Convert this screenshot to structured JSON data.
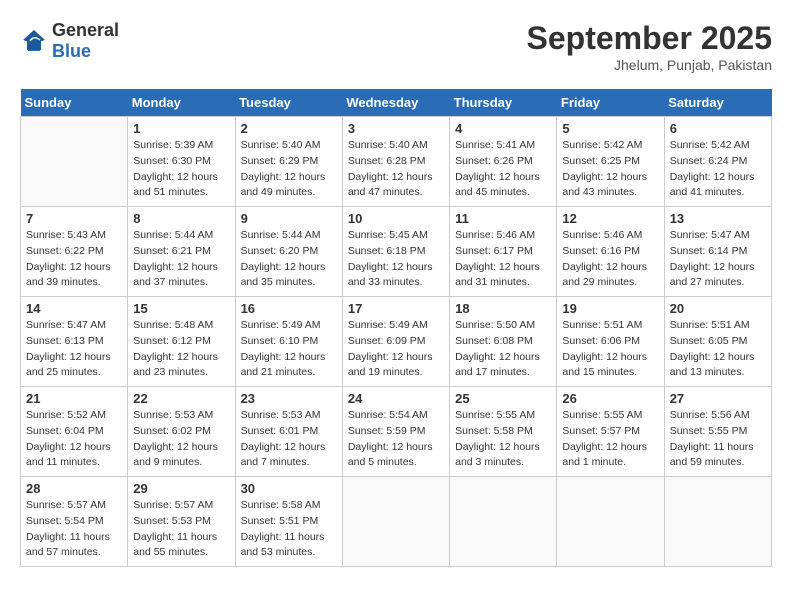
{
  "header": {
    "logo_general": "General",
    "logo_blue": "Blue",
    "title": "September 2025",
    "location": "Jhelum, Punjab, Pakistan"
  },
  "columns": [
    "Sunday",
    "Monday",
    "Tuesday",
    "Wednesday",
    "Thursday",
    "Friday",
    "Saturday"
  ],
  "weeks": [
    [
      {
        "day": "",
        "info": ""
      },
      {
        "day": "1",
        "sunrise": "5:39 AM",
        "sunset": "6:30 PM",
        "daylight": "12 hours and 51 minutes."
      },
      {
        "day": "2",
        "sunrise": "5:40 AM",
        "sunset": "6:29 PM",
        "daylight": "12 hours and 49 minutes."
      },
      {
        "day": "3",
        "sunrise": "5:40 AM",
        "sunset": "6:28 PM",
        "daylight": "12 hours and 47 minutes."
      },
      {
        "day": "4",
        "sunrise": "5:41 AM",
        "sunset": "6:26 PM",
        "daylight": "12 hours and 45 minutes."
      },
      {
        "day": "5",
        "sunrise": "5:42 AM",
        "sunset": "6:25 PM",
        "daylight": "12 hours and 43 minutes."
      },
      {
        "day": "6",
        "sunrise": "5:42 AM",
        "sunset": "6:24 PM",
        "daylight": "12 hours and 41 minutes."
      }
    ],
    [
      {
        "day": "7",
        "sunrise": "5:43 AM",
        "sunset": "6:22 PM",
        "daylight": "12 hours and 39 minutes."
      },
      {
        "day": "8",
        "sunrise": "5:44 AM",
        "sunset": "6:21 PM",
        "daylight": "12 hours and 37 minutes."
      },
      {
        "day": "9",
        "sunrise": "5:44 AM",
        "sunset": "6:20 PM",
        "daylight": "12 hours and 35 minutes."
      },
      {
        "day": "10",
        "sunrise": "5:45 AM",
        "sunset": "6:18 PM",
        "daylight": "12 hours and 33 minutes."
      },
      {
        "day": "11",
        "sunrise": "5:46 AM",
        "sunset": "6:17 PM",
        "daylight": "12 hours and 31 minutes."
      },
      {
        "day": "12",
        "sunrise": "5:46 AM",
        "sunset": "6:16 PM",
        "daylight": "12 hours and 29 minutes."
      },
      {
        "day": "13",
        "sunrise": "5:47 AM",
        "sunset": "6:14 PM",
        "daylight": "12 hours and 27 minutes."
      }
    ],
    [
      {
        "day": "14",
        "sunrise": "5:47 AM",
        "sunset": "6:13 PM",
        "daylight": "12 hours and 25 minutes."
      },
      {
        "day": "15",
        "sunrise": "5:48 AM",
        "sunset": "6:12 PM",
        "daylight": "12 hours and 23 minutes."
      },
      {
        "day": "16",
        "sunrise": "5:49 AM",
        "sunset": "6:10 PM",
        "daylight": "12 hours and 21 minutes."
      },
      {
        "day": "17",
        "sunrise": "5:49 AM",
        "sunset": "6:09 PM",
        "daylight": "12 hours and 19 minutes."
      },
      {
        "day": "18",
        "sunrise": "5:50 AM",
        "sunset": "6:08 PM",
        "daylight": "12 hours and 17 minutes."
      },
      {
        "day": "19",
        "sunrise": "5:51 AM",
        "sunset": "6:06 PM",
        "daylight": "12 hours and 15 minutes."
      },
      {
        "day": "20",
        "sunrise": "5:51 AM",
        "sunset": "6:05 PM",
        "daylight": "12 hours and 13 minutes."
      }
    ],
    [
      {
        "day": "21",
        "sunrise": "5:52 AM",
        "sunset": "6:04 PM",
        "daylight": "12 hours and 11 minutes."
      },
      {
        "day": "22",
        "sunrise": "5:53 AM",
        "sunset": "6:02 PM",
        "daylight": "12 hours and 9 minutes."
      },
      {
        "day": "23",
        "sunrise": "5:53 AM",
        "sunset": "6:01 PM",
        "daylight": "12 hours and 7 minutes."
      },
      {
        "day": "24",
        "sunrise": "5:54 AM",
        "sunset": "5:59 PM",
        "daylight": "12 hours and 5 minutes."
      },
      {
        "day": "25",
        "sunrise": "5:55 AM",
        "sunset": "5:58 PM",
        "daylight": "12 hours and 3 minutes."
      },
      {
        "day": "26",
        "sunrise": "5:55 AM",
        "sunset": "5:57 PM",
        "daylight": "12 hours and 1 minute."
      },
      {
        "day": "27",
        "sunrise": "5:56 AM",
        "sunset": "5:55 PM",
        "daylight": "11 hours and 59 minutes."
      }
    ],
    [
      {
        "day": "28",
        "sunrise": "5:57 AM",
        "sunset": "5:54 PM",
        "daylight": "11 hours and 57 minutes."
      },
      {
        "day": "29",
        "sunrise": "5:57 AM",
        "sunset": "5:53 PM",
        "daylight": "11 hours and 55 minutes."
      },
      {
        "day": "30",
        "sunrise": "5:58 AM",
        "sunset": "5:51 PM",
        "daylight": "11 hours and 53 minutes."
      },
      {
        "day": "",
        "info": ""
      },
      {
        "day": "",
        "info": ""
      },
      {
        "day": "",
        "info": ""
      },
      {
        "day": "",
        "info": ""
      }
    ]
  ]
}
